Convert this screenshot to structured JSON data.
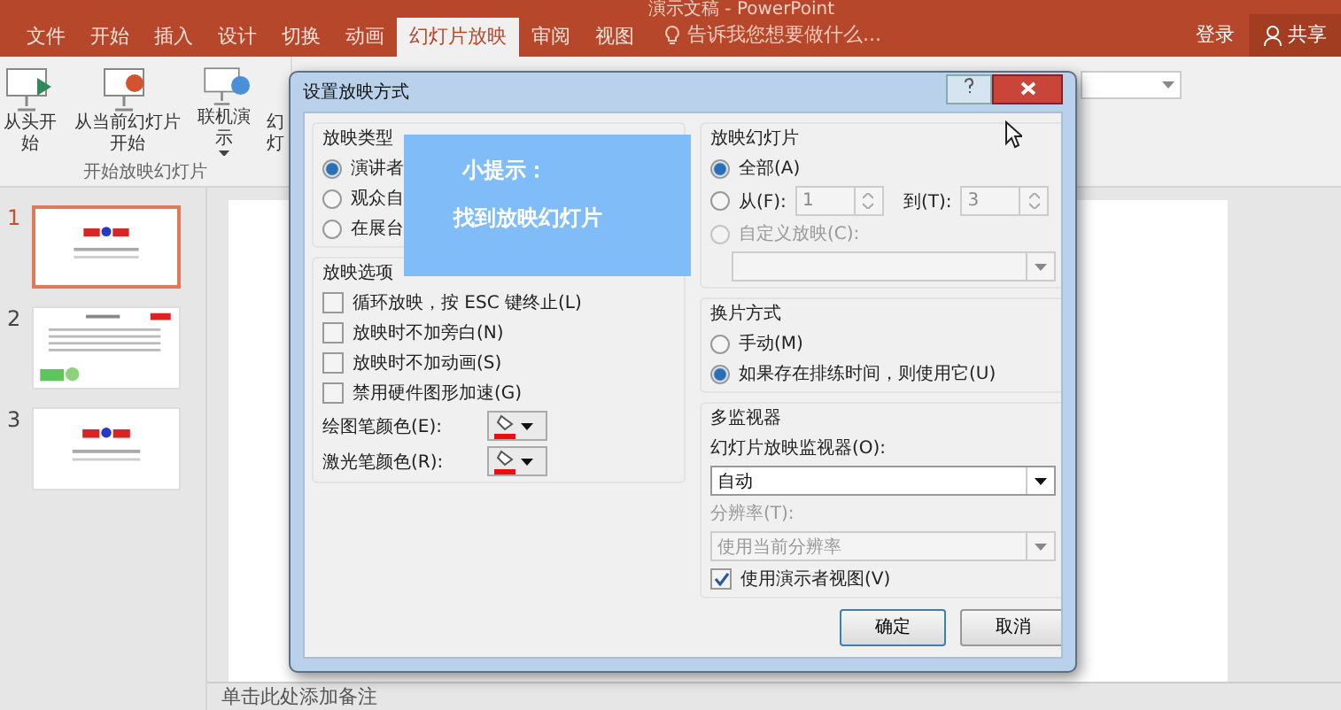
{
  "window": {
    "title": "演示文稿 - PowerPoint"
  },
  "ribbon_tabs": [
    {
      "label": "文件",
      "selected": false
    },
    {
      "label": "开始",
      "selected": false
    },
    {
      "label": "插入",
      "selected": false
    },
    {
      "label": "设计",
      "selected": false
    },
    {
      "label": "切换",
      "selected": false
    },
    {
      "label": "动画",
      "selected": false
    },
    {
      "label": "幻灯片放映",
      "selected": true
    },
    {
      "label": "审阅",
      "selected": false
    },
    {
      "label": "视图",
      "selected": false
    }
  ],
  "tell_me": {
    "placeholder": "告诉我您想要做什么..."
  },
  "account": {
    "sign_in": "登录",
    "share": "共享"
  },
  "ribbon": {
    "buttons": [
      {
        "label": "从头开始",
        "kind": "play",
        "dropdown": false
      },
      {
        "label": "从当前幻灯片开始",
        "kind": "current",
        "dropdown": false
      },
      {
        "label": "联机演示",
        "kind": "online",
        "dropdown": true
      },
      {
        "label": "幻灯",
        "kind": "partial",
        "dropdown": false
      }
    ],
    "group_label": "开始放映幻灯片"
  },
  "slides": [
    {
      "number": "1",
      "selected": true,
      "kind": "title"
    },
    {
      "number": "2",
      "selected": false,
      "kind": "text"
    },
    {
      "number": "3",
      "selected": false,
      "kind": "title"
    }
  ],
  "notes": {
    "placeholder": "单击此处添加备注"
  },
  "dialog": {
    "title": "设置放映方式",
    "show_type": {
      "label": "放映类型",
      "options": [
        {
          "label": "演讲者",
          "selected": true
        },
        {
          "label": "观众自",
          "selected": false
        },
        {
          "label": "在展台",
          "selected": false
        }
      ]
    },
    "show_options": {
      "label": "放映选项",
      "items": [
        {
          "label": "循环放映，按 ESC 键终止(L)",
          "checked": false
        },
        {
          "label": "放映时不加旁白(N)",
          "checked": false
        },
        {
          "label": "放映时不加动画(S)",
          "checked": false
        },
        {
          "label": "禁用硬件图形加速(G)",
          "checked": false
        }
      ],
      "colors": [
        {
          "label": "绘图笔颜色(E):",
          "color": "#e81010"
        },
        {
          "label": "激光笔颜色(R):",
          "color": "#e81010"
        }
      ]
    },
    "slides_range": {
      "label": "放映幻灯片",
      "all": {
        "label": "全部(A)",
        "selected": true
      },
      "from": {
        "label": "从(F):",
        "selected": false,
        "value": "1"
      },
      "to": {
        "label": "到(T):",
        "value": "3"
      },
      "custom": {
        "label": "自定义放映(C):",
        "selected": false,
        "disabled": true
      }
    },
    "advance": {
      "label": "换片方式",
      "options": [
        {
          "label": "手动(M)",
          "selected": false
        },
        {
          "label": "如果存在排练时间，则使用它(U)",
          "selected": true
        }
      ]
    },
    "monitors": {
      "label": "多监视器",
      "monitor_label": "幻灯片放映监视器(O):",
      "monitor_value": "自动",
      "resolution_label": "分辨率(T):",
      "resolution_value": "使用当前分辨率",
      "resolution_disabled": true,
      "presenter_view": {
        "label": "使用演示者视图(V)",
        "checked": true
      }
    },
    "buttons": [
      {
        "label": "确定",
        "default": true
      },
      {
        "label": "取消",
        "default": false
      }
    ]
  },
  "tip": {
    "lines": [
      "小提示：",
      "找到放映幻灯片"
    ]
  }
}
